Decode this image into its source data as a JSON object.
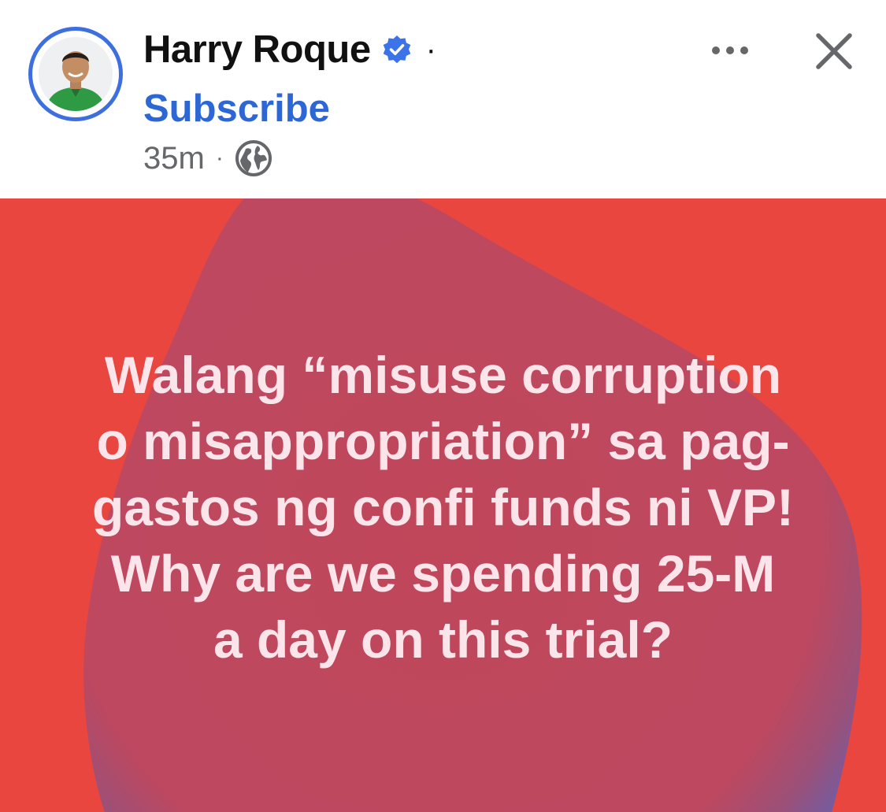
{
  "post": {
    "author": {
      "name": "Harry Roque",
      "verified": true,
      "avatar_icon": "profile-photo-icon"
    },
    "header": {
      "separator": "·",
      "subscribe_label": "Subscribe",
      "timestamp": "35m",
      "meta_separator": "·",
      "audience_icon": "globe-icon",
      "more_icon": "ellipsis-icon",
      "close_icon": "close-icon"
    },
    "content": {
      "lines": [
        "Walang “misuse corruption",
        "o misappropriation” sa pag-",
        "gastos ng confi funds ni VP!",
        "Why are we spending 25-M",
        "a day on this trial?"
      ]
    }
  },
  "colors": {
    "background_red": "#e8463f",
    "blob_center": "#c0475a",
    "blob_edge": "#7a5aa0",
    "post_text": "#fbe4ea",
    "accent_blue": "#2d67d6",
    "avatar_ring": "#3d6fe0"
  }
}
